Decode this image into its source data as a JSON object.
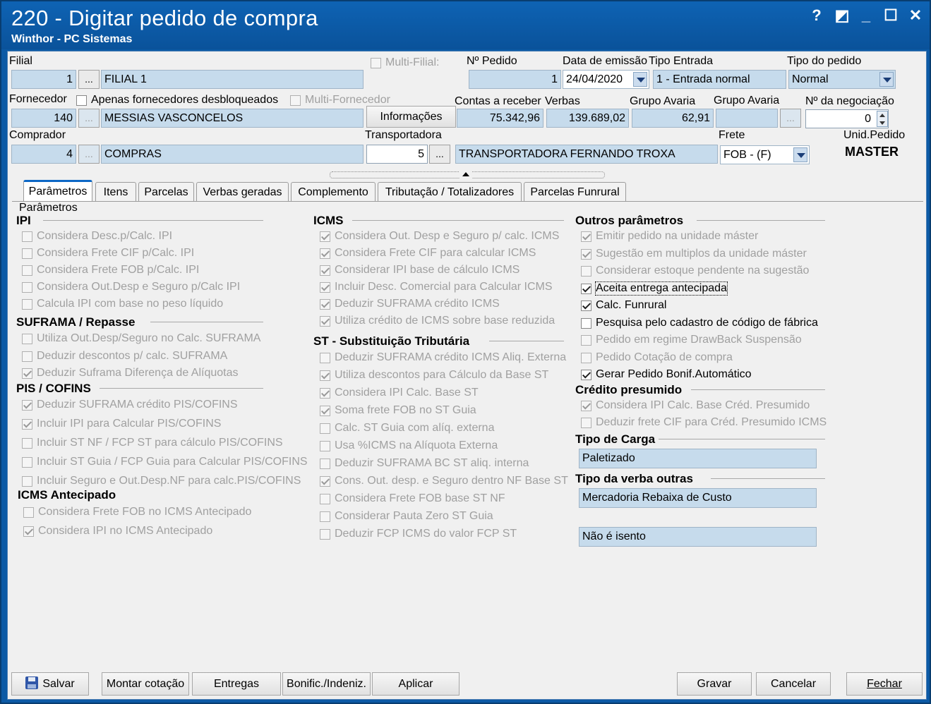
{
  "window": {
    "title": "220 - Digitar pedido de compra",
    "subtitle": "Winthor - PC Sistemas",
    "controls": [
      "?",
      "◩",
      "_",
      "☐",
      "✕"
    ]
  },
  "header": {
    "filial_label": "Filial",
    "filial_code": "1",
    "filial_name": "FILIAL 1",
    "multi_filial_label": "Multi-Filial:",
    "num_pedido_label": "Nº Pedido",
    "num_pedido": "1",
    "data_emissao_label": "Data de emissão",
    "data_emissao": "24/04/2020",
    "tipo_entrada_label": "Tipo Entrada",
    "tipo_entrada": "1 - Entrada normal",
    "tipo_pedido_label": "Tipo do pedido",
    "tipo_pedido": "Normal",
    "fornecedor_label": "Fornecedor",
    "apenas_desbloq_label": "Apenas fornecedores desbloqueados",
    "multi_fornecedor_label": "Multi-Fornecedor",
    "fornecedor_code": "140",
    "fornecedor_name": "MESSIAS VASCONCELOS",
    "informacoes_btn": "Informações",
    "contas_receber_label": "Contas a receber",
    "contas_receber": "75.342,96",
    "verbas_label": "Verbas",
    "verbas": "139.689,02",
    "grupo_avaria_label1": "Grupo Avaria",
    "grupo_avaria_value": "62,91",
    "grupo_avaria_label2": "Grupo Avaria",
    "num_negociacao_label": "Nº da negociação",
    "num_negociacao": "0",
    "comprador_label": "Comprador",
    "comprador_code": "4",
    "comprador_name": "COMPRAS",
    "transportadora_label": "Transportadora",
    "transportadora_code": "5",
    "transportadora_name": "TRANSPORTADORA FERNANDO TROXA",
    "frete_label": "Frete",
    "frete": "FOB - (F)",
    "unid_pedido_label": "Unid.Pedido",
    "unid_pedido": "MASTER",
    "dots": "..."
  },
  "tabs": [
    "Parâmetros",
    "Itens",
    "Parcelas",
    "Verbas geradas",
    "Complemento",
    "Tributação / Totalizadores",
    "Parcelas Funrural"
  ],
  "panel": {
    "parametros_label": "Parâmetros",
    "ipi": {
      "title": "IPI",
      "items": [
        {
          "label": "Considera Desc.p/Calc. IPI",
          "checked": false
        },
        {
          "label": "Considera Frete CIF p/Calc. IPI",
          "checked": false
        },
        {
          "label": "Considera Frete FOB p/Calc. IPI",
          "checked": false
        },
        {
          "label": "Considera Out.Desp e Seguro p/Calc IPI",
          "checked": false
        },
        {
          "label": "Calcula IPI com base no peso líquido",
          "checked": false
        }
      ]
    },
    "suframa": {
      "title": "SUFRAMA / Repasse",
      "items": [
        {
          "label": "Utiliza Out.Desp/Seguro no Calc. SUFRAMA",
          "checked": false
        },
        {
          "label": "Deduzir descontos p/ calc. SUFRAMA",
          "checked": false
        },
        {
          "label": "Deduzir Suframa Diferença de Alíquotas",
          "checked": true
        }
      ]
    },
    "pis": {
      "title": "PIS / COFINS",
      "items": [
        {
          "label": "Deduzir SUFRAMA crédito PIS/COFINS",
          "checked": true
        },
        {
          "label": "Incluir IPI para Calcular PIS/COFINS",
          "checked": true
        },
        {
          "label": "Incluir ST NF / FCP ST para cálculo PIS/COFINS",
          "checked": false
        },
        {
          "label": "Incluir ST Guia / FCP Guia para Calcular PIS/COFINS",
          "checked": false
        },
        {
          "label": "Incluir Seguro e Out.Desp.NF para calc.PIS/COFINS",
          "checked": false
        }
      ]
    },
    "icms_ant": {
      "title": "ICMS Antecipado",
      "items": [
        {
          "label": "Considera Frete FOB no ICMS Antecipado",
          "checked": false
        },
        {
          "label": "Considera IPI no ICMS Antecipado",
          "checked": true
        }
      ]
    },
    "icms": {
      "title": "ICMS",
      "items": [
        {
          "label": "Considera Out. Desp e Seguro p/ calc. ICMS",
          "checked": true
        },
        {
          "label": "Considera Frete CIF para calcular ICMS",
          "checked": true
        },
        {
          "label": "Considerar IPI base de cálculo ICMS",
          "checked": true
        },
        {
          "label": "Incluir Desc. Comercial  para Calcular ICMS",
          "checked": true
        },
        {
          "label": "Deduzir SUFRAMA crédito ICMS",
          "checked": true
        },
        {
          "label": "Utiliza crédito de ICMS sobre base reduzida",
          "checked": true
        }
      ]
    },
    "st": {
      "title": "ST - Substituição Tributária",
      "items": [
        {
          "label": "Deduzir SUFRAMA crédito ICMS Aliq. Externa",
          "checked": false
        },
        {
          "label": "Utiliza descontos para Cálculo da Base ST",
          "checked": true
        },
        {
          "label": "Considera IPI Calc. Base ST",
          "checked": true
        },
        {
          "label": "Soma frete FOB no ST Guia",
          "checked": true
        },
        {
          "label": "Calc. ST Guia com alíq. externa",
          "checked": false
        },
        {
          "label": "Usa %ICMS na Alíquota Externa",
          "checked": false
        },
        {
          "label": "Deduzir SUFRAMA BC ST aliq. interna",
          "checked": false
        },
        {
          "label": "Cons. Out. desp. e Seguro dentro NF Base ST",
          "checked": true
        },
        {
          "label": "Considera Frete FOB base ST NF",
          "checked": false
        },
        {
          "label": "Considerar Pauta Zero ST Guia",
          "checked": false
        },
        {
          "label": "Deduzir FCP ICMS do valor FCP ST",
          "checked": false
        }
      ]
    },
    "outros": {
      "title": "Outros parâmetros",
      "items": [
        {
          "label": "Emitir pedido na unidade máster",
          "checked": true,
          "enabled": false
        },
        {
          "label": "Sugestão em multiplos da unidade máster",
          "checked": true,
          "enabled": false
        },
        {
          "label": "Considerar estoque pendente na sugestão",
          "checked": false,
          "enabled": false
        },
        {
          "label": "Aceita entrega antecipada",
          "checked": true,
          "enabled": true
        },
        {
          "label": "Calc. Funrural",
          "checked": true,
          "enabled": true
        },
        {
          "label": "Pesquisa pelo cadastro de código de fábrica",
          "checked": false,
          "enabled": true
        },
        {
          "label": "Pedido em regime DrawBack Suspensão",
          "checked": false,
          "enabled": false
        },
        {
          "label": "Pedido Cotação de compra",
          "checked": false,
          "enabled": false
        },
        {
          "label": "Gerar Pedido Bonif.Automático",
          "checked": true,
          "enabled": true
        }
      ]
    },
    "credito": {
      "title": "Crédito presumido",
      "items": [
        {
          "label": "Considera IPI Calc. Base Créd. Presumido",
          "checked": true
        },
        {
          "label": "Deduzir frete CIF para Créd. Presumido ICMS",
          "checked": false
        }
      ]
    },
    "tipo_carga_title": "Tipo de Carga",
    "tipo_carga": "Paletizado",
    "tipo_verba_title": "Tipo da verba outras",
    "tipo_verba": "Mercadoria Rebaixa de Custo",
    "isento": "Não é isento"
  },
  "footer": {
    "salvar": "Salvar",
    "montar": "Montar cotação",
    "entregas": "Entregas",
    "bonific": "Bonific./Indeniz.",
    "aplicar": "Aplicar",
    "gravar": "Gravar",
    "cancelar": "Cancelar",
    "fechar": "Fechar"
  },
  "colors": {
    "title_bar": "#0c5aa5",
    "field_bg": "#c6dbec",
    "tab_accent": "#0d68c6"
  }
}
